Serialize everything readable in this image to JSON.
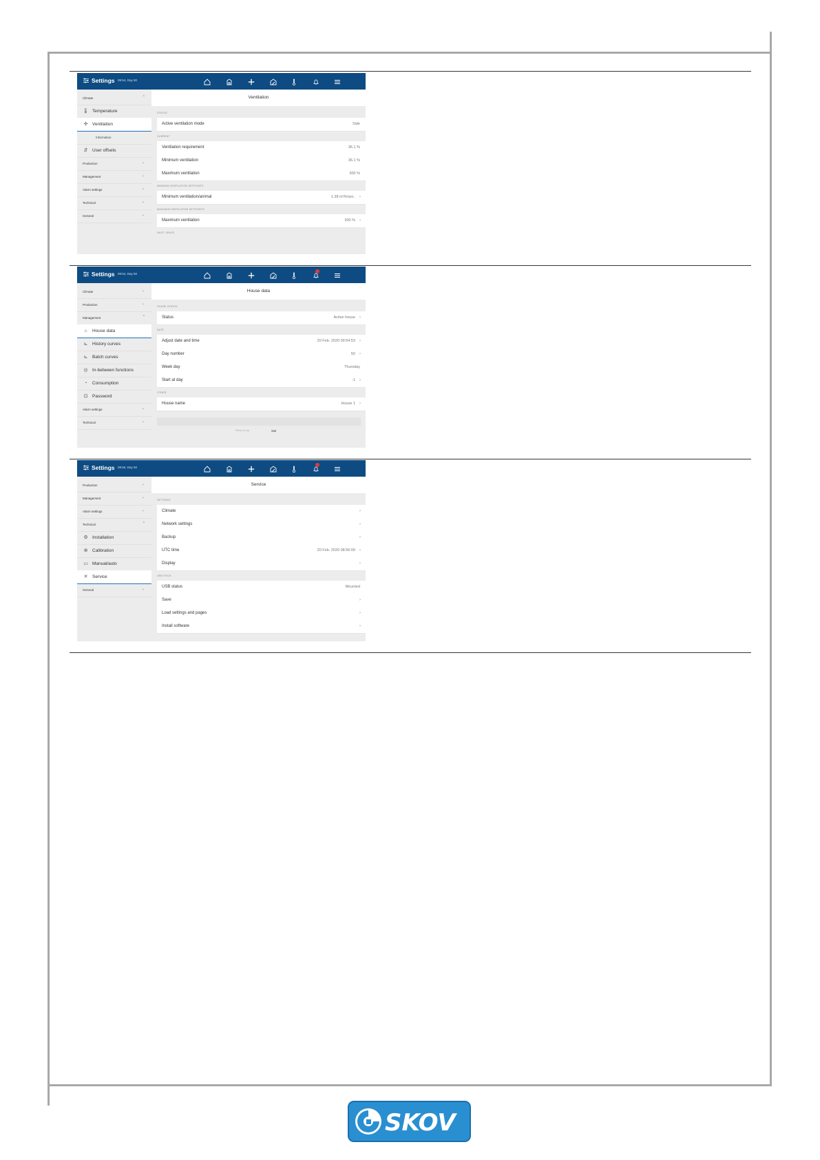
{
  "screens": [
    {
      "header": {
        "title": "Settings",
        "subtitle": "09:54, Day 50",
        "notification": false
      },
      "sidebar": [
        {
          "type": "group",
          "label": "Climate",
          "chev": "^"
        },
        {
          "type": "item",
          "label": "Temperature",
          "icon": "thermometer-icon",
          "glyph": "🌡"
        },
        {
          "type": "item",
          "label": "Ventilation",
          "icon": "fan-icon",
          "glyph": "✣",
          "active": true
        },
        {
          "type": "sub",
          "label": "Information"
        },
        {
          "type": "item",
          "label": "User offsets",
          "icon": "user-offsets-icon",
          "glyph": "⇵"
        },
        {
          "type": "group",
          "label": "Production",
          "chev": "⌄"
        },
        {
          "type": "group",
          "label": "Management",
          "chev": "⌄"
        },
        {
          "type": "group",
          "label": "Alarm settings",
          "chev": "⌄"
        },
        {
          "type": "group",
          "label": "Technical",
          "chev": "⌄"
        },
        {
          "type": "group",
          "label": "General",
          "chev": "⌄"
        }
      ],
      "main": {
        "title": "Ventilation",
        "blocks": [
          {
            "section": "STATUS",
            "rows": [
              {
                "key": "Active ventilation mode",
                "value": "Side",
                "chev": false
              }
            ]
          },
          {
            "section": "CURRENT",
            "rows": [
              {
                "key": "Ventilation requirement",
                "value": "36.1 %",
                "chev": false
              },
              {
                "key": "Minimum ventilation",
                "value": "36.1 %",
                "chev": false
              },
              {
                "key": "Maximum ventilation",
                "value": "300 %",
                "chev": false
              }
            ]
          },
          {
            "section": "MINIMUM VENTILATION SETPOINTS",
            "rows": [
              {
                "key": "Minimum ventilation/animal",
                "value": "1.38 m³/h/ani..",
                "chev": true
              }
            ]
          },
          {
            "section": "MAXIMUM VENTILATION SETPOINTS",
            "rows": [
              {
                "key": "Maximum ventilation",
                "value": "300 %",
                "chev": true
              }
            ]
          },
          {
            "section": "INLET SPACE",
            "rows": []
          }
        ],
        "footer": null
      }
    },
    {
      "header": {
        "title": "Settings",
        "subtitle": "09:54, Day 50",
        "notification": true
      },
      "sidebar": [
        {
          "type": "group",
          "label": "Climate",
          "chev": "⌄"
        },
        {
          "type": "group",
          "label": "Production",
          "chev": "⌄"
        },
        {
          "type": "group",
          "label": "Management",
          "chev": "^"
        },
        {
          "type": "item",
          "label": "House data",
          "icon": "house-icon",
          "glyph": "⌂",
          "active": true
        },
        {
          "type": "item",
          "label": "History curves",
          "icon": "chart-icon",
          "glyph": "⊾"
        },
        {
          "type": "item",
          "label": "Batch curves",
          "icon": "batch-chart-icon",
          "glyph": "⊾"
        },
        {
          "type": "item",
          "label": "In-between functions",
          "icon": "function-icon",
          "glyph": "◎"
        },
        {
          "type": "item",
          "label": "Consumption",
          "icon": "consumption-icon",
          "glyph": "◔"
        },
        {
          "type": "item",
          "label": "Password",
          "icon": "lock-icon",
          "glyph": "⊡"
        },
        {
          "type": "group",
          "label": "Alarm settings",
          "chev": "⌄"
        },
        {
          "type": "group",
          "label": "Technical",
          "chev": "⌄"
        }
      ],
      "main": {
        "title": "House data",
        "blocks": [
          {
            "section": "HOUSE STATUS",
            "rows": [
              {
                "key": "Status",
                "value": "Active house",
                "chev": true
              }
            ]
          },
          {
            "section": "DATE",
            "rows": [
              {
                "key": "Adjust date and time",
                "value": "20 Feb. 2020 09:54:53",
                "chev": true
              },
              {
                "key": "Day number",
                "value": "50",
                "chev": true
              },
              {
                "key": "Week day",
                "value": "Thursday",
                "chev": false
              },
              {
                "key": "Start at day",
                "value": "-1",
                "chev": true
              }
            ]
          },
          {
            "section": "OTHER",
            "rows": [
              {
                "key": "House name",
                "value": "House 1",
                "chev": true
              }
            ]
          }
        ],
        "footer": {
          "text": "Return to top",
          "mark": "Swi"
        }
      }
    },
    {
      "header": {
        "title": "Settings",
        "subtitle": "09:56, Day 50",
        "notification": true
      },
      "sidebar": [
        {
          "type": "group",
          "label": "Production",
          "chev": "⌄"
        },
        {
          "type": "group",
          "label": "Management",
          "chev": "⌄"
        },
        {
          "type": "group",
          "label": "Alarm settings",
          "chev": "⌄"
        },
        {
          "type": "group",
          "label": "Technical",
          "chev": "^"
        },
        {
          "type": "item",
          "label": "Installation",
          "icon": "installation-icon",
          "glyph": "⚙"
        },
        {
          "type": "item",
          "label": "Calibration",
          "icon": "calibration-icon",
          "glyph": "⊕"
        },
        {
          "type": "item",
          "label": "Manual/auto",
          "icon": "manual-auto-icon",
          "glyph": "▭"
        },
        {
          "type": "item",
          "label": "Service",
          "icon": "tools-icon",
          "glyph": "✕",
          "active": true
        },
        {
          "type": "group",
          "label": "General",
          "chev": "⌄"
        }
      ],
      "main": {
        "title": "Service",
        "blocks": [
          {
            "section": "SETTINGS",
            "rows": [
              {
                "key": "Climate",
                "value": "",
                "chev": true
              },
              {
                "key": "Network settings",
                "value": "",
                "chev": true
              },
              {
                "key": "Backup",
                "value": "",
                "chev": true
              },
              {
                "key": "UTC time",
                "value": "20 Feb. 2020 08:56:09",
                "chev": true
              },
              {
                "key": "Display",
                "value": "",
                "chev": true
              }
            ]
          },
          {
            "section": "USB STICK",
            "rows": [
              {
                "key": "USB status",
                "value": "Mounted",
                "chev": false
              },
              {
                "key": "Save",
                "value": "",
                "chev": true
              },
              {
                "key": "Load settings and pages",
                "value": "",
                "chev": true
              },
              {
                "key": "Install software",
                "value": "",
                "chev": true
              }
            ]
          }
        ],
        "footer": null
      }
    }
  ],
  "logo": {
    "text": "SKOV",
    "bg_color": "#2a8fd0",
    "text_color": "#ffffff"
  },
  "colors": {
    "topbar": "#0e4b82",
    "active_underline": "#1f6fb5",
    "notification": "#e03a3a"
  }
}
